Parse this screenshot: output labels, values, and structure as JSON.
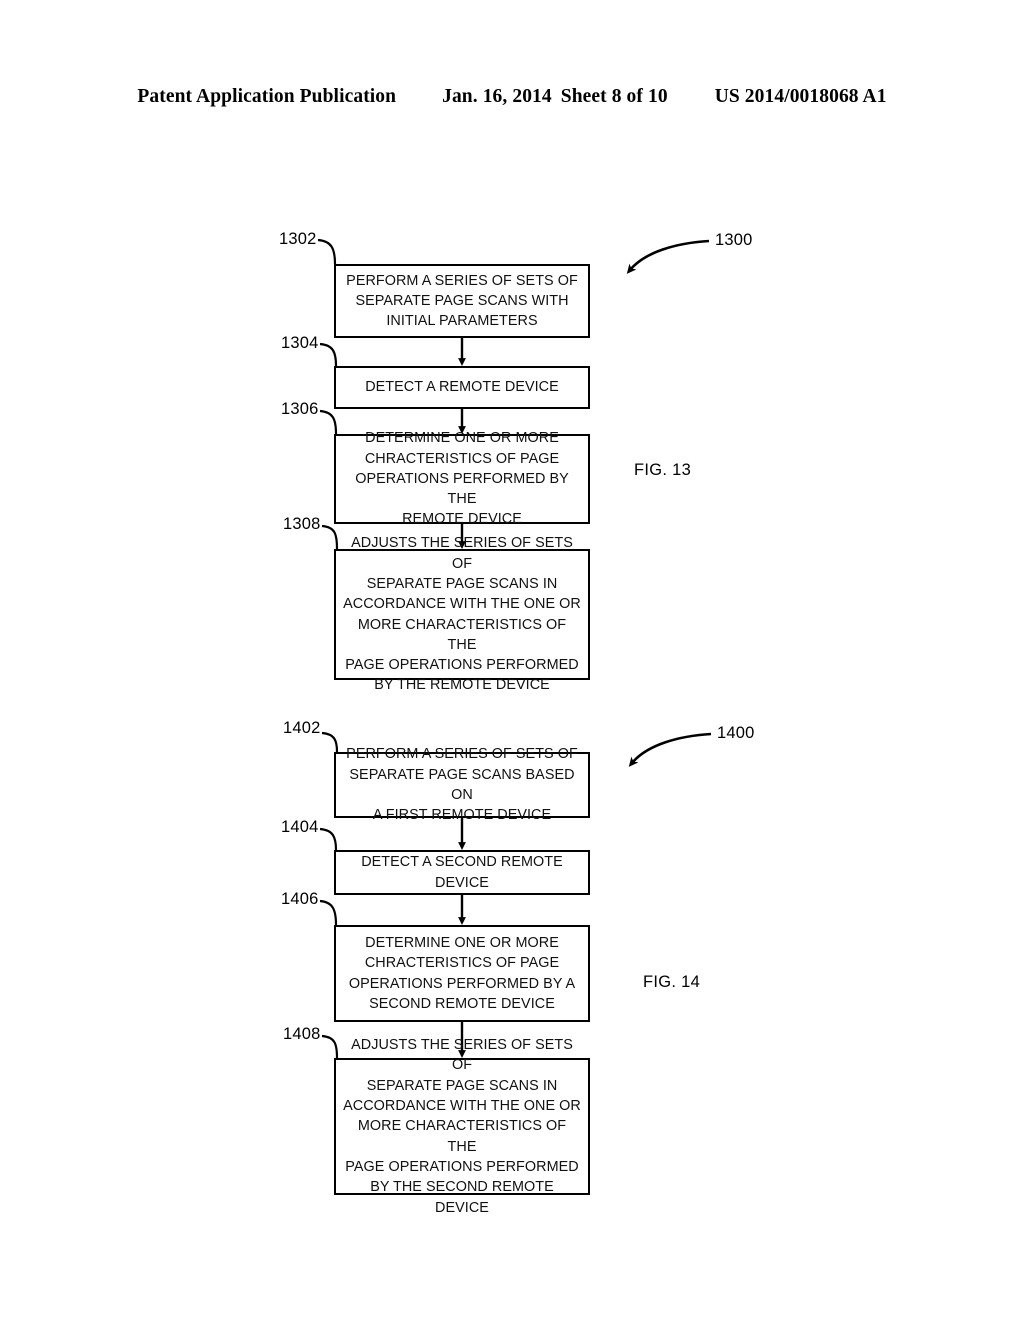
{
  "header": {
    "publication": "Patent Application Publication",
    "date": "Jan. 16, 2014",
    "sheet": "Sheet 8 of 10",
    "patent_number": "US 2014/0018068 A1"
  },
  "figures": [
    {
      "caption": "FIG. 13",
      "callout": "1300",
      "steps": [
        {
          "ref": "1302",
          "text": "PERFORM A SERIES OF SETS OF\nSEPARATE PAGE SCANS WITH\nINITIAL PARAMETERS"
        },
        {
          "ref": "1304",
          "text": "DETECT A REMOTE DEVICE"
        },
        {
          "ref": "1306",
          "text": "DETERMINE ONE OR MORE\nCHRACTERISTICS OF PAGE\nOPERATIONS PERFORMED BY THE\nREMOTE DEVICE"
        },
        {
          "ref": "1308",
          "text": "ADJUSTS THE SERIES OF SETS OF\nSEPARATE PAGE SCANS IN\nACCORDANCE WITH THE ONE OR\nMORE CHARACTERISTICS OF THE\nPAGE OPERATIONS PERFORMED\nBY THE REMOTE DEVICE"
        }
      ]
    },
    {
      "caption": "FIG. 14",
      "callout": "1400",
      "steps": [
        {
          "ref": "1402",
          "text": "PERFORM A SERIES OF SETS OF\nSEPARATE PAGE SCANS BASED ON\nA FIRST REMOTE DEVICE"
        },
        {
          "ref": "1404",
          "text": "DETECT A SECOND REMOTE\nDEVICE"
        },
        {
          "ref": "1406",
          "text": "DETERMINE ONE OR MORE\nCHRACTERISTICS OF PAGE\nOPERATIONS PERFORMED BY A\nSECOND REMOTE DEVICE"
        },
        {
          "ref": "1408",
          "text": "ADJUSTS THE SERIES OF SETS OF\nSEPARATE PAGE SCANS IN\nACCORDANCE WITH THE ONE OR\nMORE CHARACTERISTICS OF THE\nPAGE OPERATIONS PERFORMED\nBY THE SECOND REMOTE DEVICE"
        }
      ]
    }
  ],
  "colors": {
    "ink": "#000000",
    "paper": "#ffffff"
  }
}
